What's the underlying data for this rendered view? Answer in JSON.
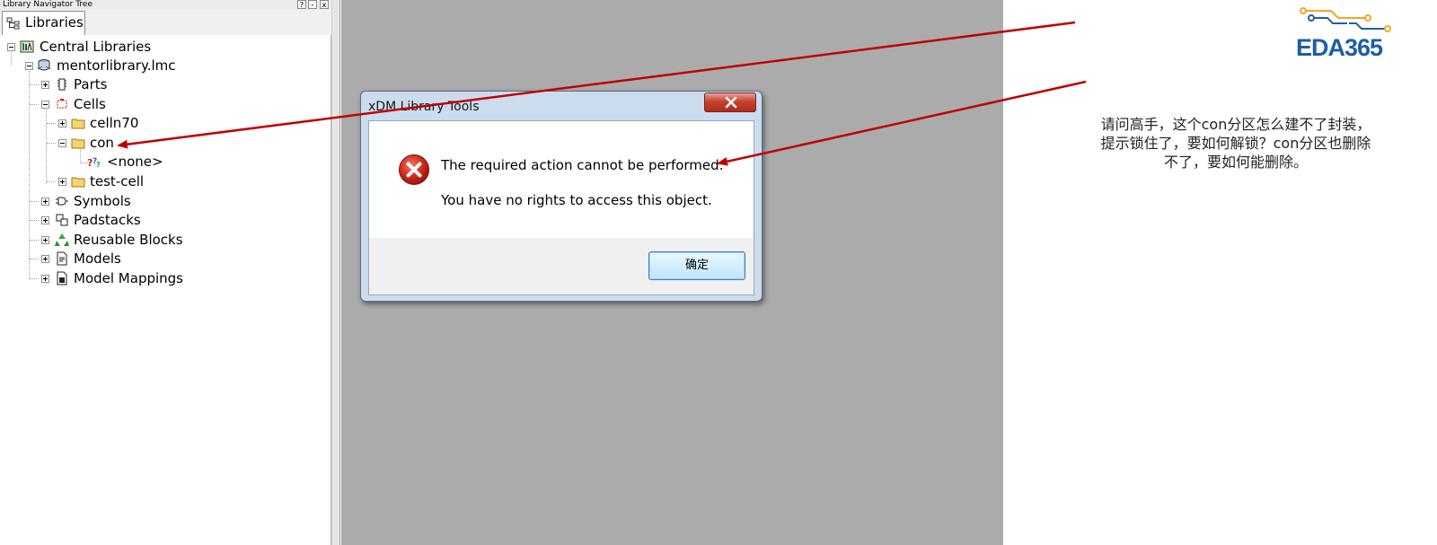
{
  "panel": {
    "title": "Library Navigator Tree",
    "title_buttons": [
      "?",
      "-",
      "x"
    ],
    "tab_label": "Libraries",
    "tab_icon": "tree-icon"
  },
  "tree": [
    {
      "label": "Central Libraries",
      "icon": "library-icon",
      "expanded": true
    },
    {
      "label": "mentorlibrary.lmc",
      "icon": "database-icon",
      "expanded": true
    },
    {
      "label": "Parts",
      "icon": "part-chip-icon",
      "expanded": false
    },
    {
      "label": "Cells",
      "icon": "cell-icon",
      "expanded": true
    },
    {
      "label": "celln70",
      "icon": "folder-icon",
      "expanded": false
    },
    {
      "label": "con",
      "icon": "folder-open-icon",
      "expanded": true
    },
    {
      "label": "<none>",
      "icon": "unknown-question-icon"
    },
    {
      "label": "test-cell",
      "icon": "folder-icon",
      "expanded": false
    },
    {
      "label": "Symbols",
      "icon": "symbol-icon",
      "expanded": false
    },
    {
      "label": "Padstacks",
      "icon": "padstack-icon",
      "expanded": false
    },
    {
      "label": "Reusable Blocks",
      "icon": "recycle-icon",
      "expanded": false
    },
    {
      "label": "Models",
      "icon": "model-doc-icon",
      "expanded": false
    },
    {
      "label": "Model Mappings",
      "icon": "mapping-doc-icon",
      "expanded": false
    }
  ],
  "dialog": {
    "title": "xDM Library Tools",
    "message_line1": "The required action cannot be performed:",
    "message_line2": "You have no rights to access this object.",
    "ok_label": "确定",
    "icon": "error-x-icon"
  },
  "logo": {
    "text": "EDA365"
  },
  "annotation": {
    "question": "请问高手，这个con分区怎么建不了封装，提示锁住了，要如何解锁？con分区也删除不了，要如何能删除。"
  },
  "colors": {
    "workarea": "#ababab",
    "arrow": "#c00000",
    "logo_blue": "#1c5ea8",
    "logo_orange": "#f5a623"
  }
}
